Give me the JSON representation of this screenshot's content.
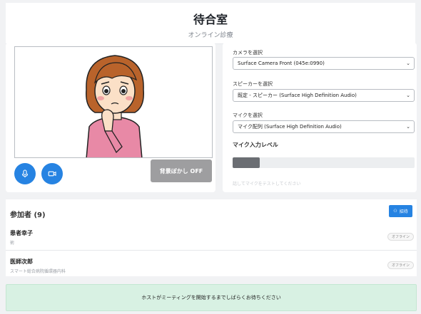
{
  "header": {
    "title": "待合室",
    "subtitle": "オンライン診療"
  },
  "controls": {
    "blur_label": "背景ぼかし OFF",
    "mic_icon": "microphone-icon",
    "camera_icon": "video-camera-icon"
  },
  "settings": {
    "camera_label": "カメラを選択",
    "camera_value": "Surface Camera Front (045e:0990)",
    "speaker_label": "スピーカーを選択",
    "speaker_value": "既定 - スピーカー (Surface High Definition Audio)",
    "mic_label": "マイクを選択",
    "mic_value": "マイク配列 (Surface High Definition Audio)",
    "mic_level_label": "マイク入力レベル",
    "mic_level": 0.15,
    "hint": "話してマイクをテストしてください"
  },
  "participants": {
    "title": "参加者 (9)",
    "invite_label": "招待",
    "items": [
      {
        "name": "患者幸子",
        "sub": "術",
        "status": "オフライン"
      },
      {
        "name": "医師次郎",
        "sub": "スマート総合病院循環器内科",
        "status": "オフライン"
      }
    ]
  },
  "banner": {
    "text": "ホストがミーティングを開始するまでしばらくお待ちください"
  },
  "colors": {
    "accent": "#2683e2",
    "banner_bg": "#d8f1e3",
    "blur_btn": "#9e9ea0"
  }
}
